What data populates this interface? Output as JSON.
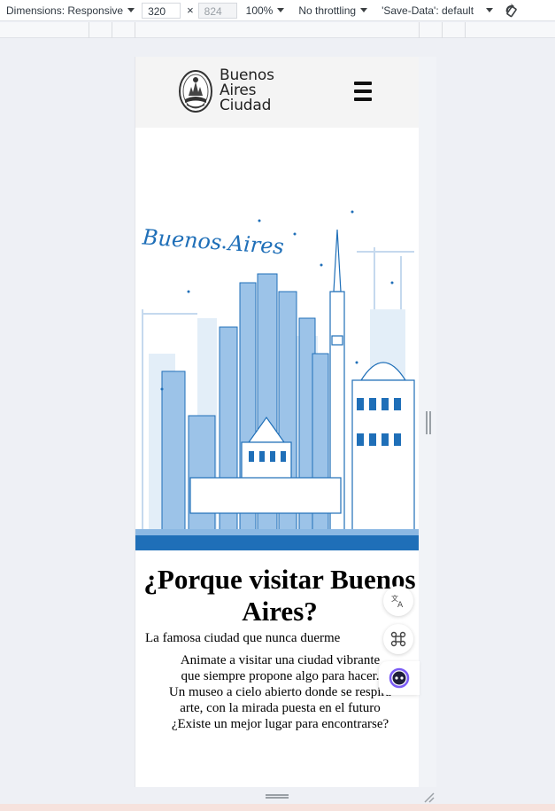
{
  "devtools": {
    "dimensions_label": "Dimensions: Responsive",
    "width_value": "320",
    "times": "×",
    "height_value": "824",
    "zoom": "100%",
    "throttling": "No throttling",
    "save_data": "'Save-Data': default"
  },
  "site": {
    "logo_line1": "Buenos",
    "logo_line2": "Aires",
    "logo_line3": "Ciudad",
    "hero_script": "Buenos Aires",
    "heading": "¿Porque visitar Buenos Aires?",
    "subtitle": "La famosa ciudad que nunca duerme",
    "para_line1": "Animate a visitar una ciudad vibrante",
    "para_line2": "que siempre propone algo para hacer.",
    "para_line3": "Un museo a cielo abierto donde se respira arte, con la mirada puesta en el futuro",
    "para_line4": "¿Existe un mejor lugar para encontrarse?"
  },
  "colors": {
    "skyline_blue": "#1f6fb8",
    "skyline_light": "#8bb8e3",
    "header_bg": "#f4f4f4"
  }
}
